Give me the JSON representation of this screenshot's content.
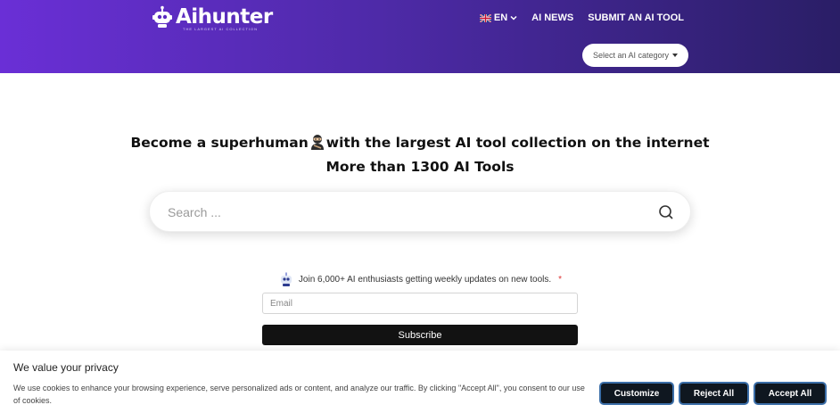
{
  "header": {
    "logo_text": "Aihunter",
    "logo_tagline": "THE LARGEST AI COLLECTION",
    "nav": {
      "language": "EN",
      "ai_news": "AI NEWS",
      "submit": "SUBMIT AN AI TOOL"
    },
    "category_select": {
      "selected": "Select an AI category"
    }
  },
  "hero": {
    "line1_before": "Become a superhuman",
    "line1_after": "with the largest AI tool collection on the internet",
    "line2": "More than 1300 AI Tools"
  },
  "search": {
    "placeholder": "Search ...",
    "icon": "search-icon"
  },
  "newsletter": {
    "join_text": "Join 6,000+ AI enthusiasts getting weekly updates on new tools.",
    "required_mark": "*",
    "email_placeholder": "Email",
    "subscribe_label": "Subscribe"
  },
  "cookie": {
    "title": "We value your privacy",
    "text": "We use cookies to enhance your browsing experience, serve personalized ads or content, and analyze our traffic. By clicking \"Accept All\", you consent to our use of cookies.",
    "customize_label": "Customize",
    "reject_label": "Reject All",
    "accept_label": "Accept All"
  },
  "colors": {
    "header_gradient_start": "#6a2fd6",
    "header_gradient_end": "#2a1e66",
    "button_dark": "#0f1720",
    "button_border": "#3b6ea8"
  }
}
